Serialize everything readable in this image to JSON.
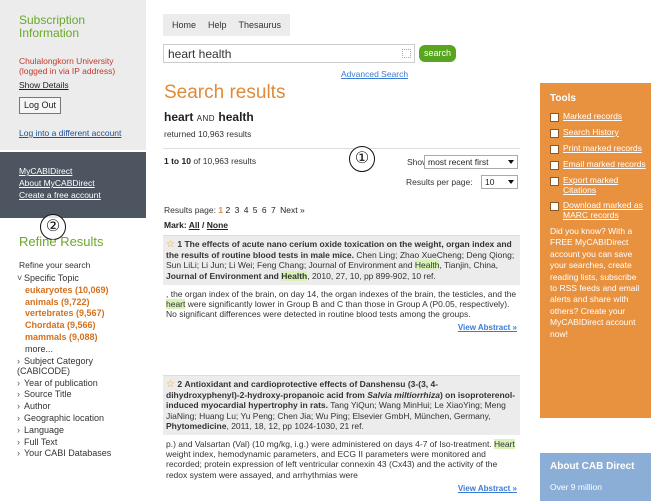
{
  "sidebar": {
    "subscription_title": "Subscription Information",
    "org_line1": "Chulalongkorn University",
    "org_line2": "(logged in via IP address)",
    "show_details": "Show Details",
    "logout": "Log Out",
    "login_other": "Log into a different account",
    "dark_links": [
      "MyCABIDirect",
      "About MyCABDirect",
      "Create a free account"
    ],
    "annotation_2": "②",
    "refine_title": "Refine Results",
    "refine_sub": "Refine your search",
    "specific_topic": "Specific Topic",
    "topic_options": [
      "eukaryotes (10,069)",
      "animals (9,722)",
      "vertebrates (9,567)",
      "Chordata (9,566)",
      "mammals (9,088)"
    ],
    "more": "more...",
    "facets": [
      "Subject Category (CABICODE)",
      "Year of publication",
      "Source Title",
      "Author",
      "Geographic location",
      "Language",
      "Full Text",
      "Your CABI Databases"
    ]
  },
  "main": {
    "tabs": [
      "Home",
      "Help",
      "Thesaurus"
    ],
    "search_value": "heart health",
    "search_button": "search",
    "advanced_search": "Advanced Search",
    "title": "Search results",
    "query_a": "heart",
    "query_and": "AND",
    "query_b": "health",
    "returned": "returned 10,963 results",
    "range_bold": "1 to 10",
    "range_rest": "of 10,963 results",
    "annotation_1": "①",
    "show_me": "Show me:",
    "sort_value": "most recent first",
    "per_page_label": "Results per page:",
    "per_page_value": "10",
    "pages_label": "Results page:",
    "pages_current": "1",
    "pages_others": [
      "2",
      "3",
      "4",
      "5",
      "6",
      "7",
      "Next »"
    ],
    "mark_label": "Mark:",
    "mark_all": "All",
    "mark_sep": "/",
    "mark_none": "None",
    "results": [
      {
        "num": "1",
        "title": "The effects of acute nano cerium oxide toxication on the weight, organ index and the results of routine blood tests in male mice.",
        "authors": "Chen Ling; Zhao XueCheng; Deng Qiong; Sun LiLi; Li Jun; Li Wei; Feng Chang; Journal of Environment and",
        "hl1": "Health",
        "mid1": ", Tianjin, China,",
        "journal": "Journal of Environment and",
        "hl2": "Health",
        "tail": ", 2010, 27, 10, pp 899-902, 10 ref.",
        "abs_a": ", the organ index of the brain, on day 14, the organ indexes of the brain, the testicles, and the",
        "abs_hl": "heart",
        "abs_b": "were significantly lower in Group B and C than those in Group A (P0.05, respectively). No significant differences were detected in routine blood tests among the groups.",
        "view": "View Abstract »"
      },
      {
        "num": "2",
        "title_a": "Antioxidant and cardioprotective effects of Danshensu (3-(3, 4-dihydroxyphenyl)-2-hydroxy-propanoic acid from",
        "title_i": "Salvia miltiorrhiza",
        "title_b": ") on isoproterenol-induced myocardial hypertrophy in rats.",
        "authors": "Tang YiQun; Wang MinHui; Le XiaoYing; Meng JiaNing; Huang Lu; Yu Peng; Chen Jia; Wu Ping; Elsevier GmbH, München, Germany,",
        "journal": "Phytomedicine",
        "tail": ", 2011, 18, 12, pp 1024-1030, 21 ref.",
        "abs_a": "p.) and Valsartan (Val) (10 mg/kg, i.g.) were administered on days 4-7 of Iso-treatment.",
        "abs_hl": "Heart",
        "abs_b": "weight index, hemodynamic parameters, and ECG II parameters were monitored and recorded; protein expression of left ventricular connexin 43 (Cx43) and the activity of the redox system were assayed, and arrhythmias were",
        "view": "View Abstract »"
      }
    ]
  },
  "tools": {
    "title": "Tools",
    "items": [
      "Marked records",
      "Search History",
      "Print marked records",
      "Email marked records",
      "Export marked Citations",
      "Download marked as MARC records"
    ],
    "did_you_know": "Did you know? With a FREE MyCABIDirect account you can save your searches, create reading lists, subscribe to RSS feeds and email alerts and share with others? Create your MyCABIDirect account now!"
  },
  "about": {
    "title": "About CAB Direct",
    "text": "Over 9 million"
  },
  "colors": {
    "accent_green": "#6aa829",
    "accent_orange": "#e89240",
    "title_orange": "#e08a3a",
    "dark_box": "#4d5660",
    "about_blue": "#8aaed6"
  }
}
